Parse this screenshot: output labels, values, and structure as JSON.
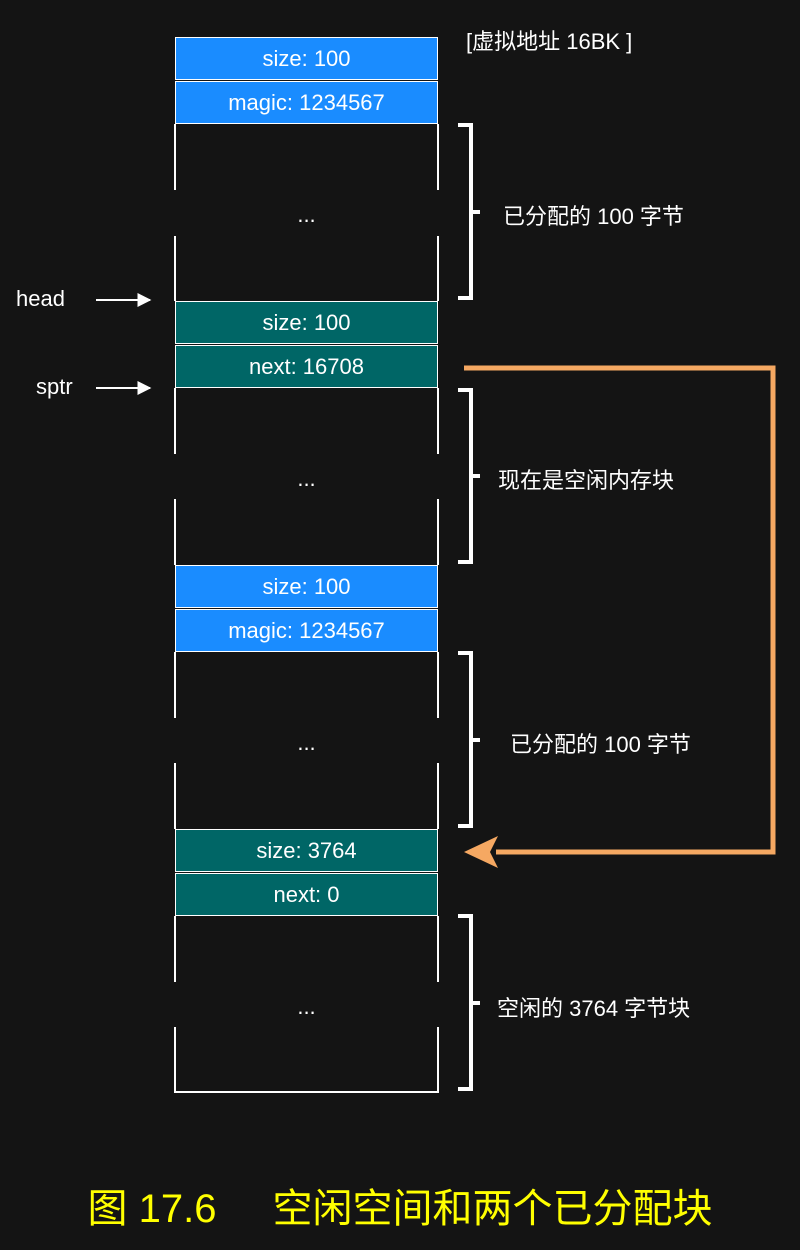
{
  "header": {
    "address_label": "[虚拟地址 16BK ]"
  },
  "pointers": {
    "head": "head",
    "sptr": "sptr"
  },
  "blocks": [
    {
      "header_top": "size: 100",
      "header_bottom": "magic: 1234567",
      "body": "...",
      "brace_label": "已分配的 100 字节"
    },
    {
      "header_top": "size: 100",
      "header_bottom": "next: 16708",
      "body": "...",
      "brace_label": "现在是空闲内存块"
    },
    {
      "header_top": "size: 100",
      "header_bottom": "magic: 1234567",
      "body": "...",
      "brace_label": "已分配的 100 字节"
    },
    {
      "header_top": "size: 3764",
      "header_bottom": "next: 0",
      "body": "...",
      "brace_label": "空闲的 3764 字节块"
    }
  ],
  "caption": {
    "number": "图 17.6",
    "title": "空闲空间和两个已分配块"
  },
  "colors": {
    "background": "#141414",
    "allocated_header": "#1a8cff",
    "free_header": "#006666",
    "link_arrow": "#f5a862",
    "caption": "#ffff00"
  }
}
